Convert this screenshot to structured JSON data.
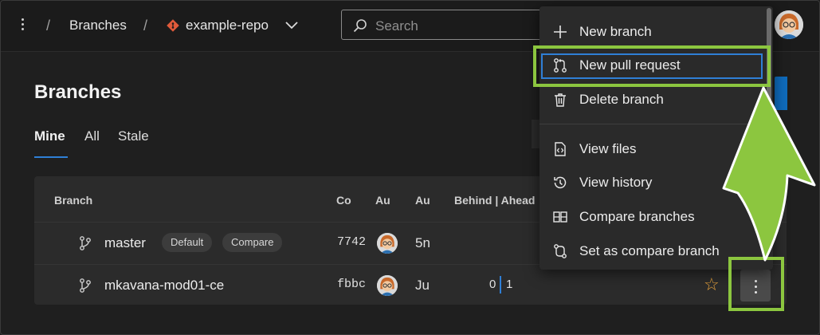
{
  "topbar": {
    "breadcrumb_sep1": "/",
    "breadcrumb_branches": "Branches",
    "breadcrumb_sep2": "/",
    "repo_name": "example-repo",
    "search_placeholder": "Search"
  },
  "page": {
    "title": "Branches",
    "tabs": [
      "Mine",
      "All",
      "Stale"
    ],
    "active_tab": "Mine"
  },
  "table": {
    "headers": [
      "Branch",
      "Co",
      "Au",
      "Au",
      "Behind | Ahead"
    ],
    "rows": [
      {
        "name": "master",
        "badges": [
          "Default",
          "Compare"
        ],
        "commit": "7742",
        "age": "5n"
      },
      {
        "name": "mkavana-mod01-ce",
        "commit": "fbbc",
        "age": "Ju",
        "behind": "0",
        "ahead": "1"
      }
    ]
  },
  "menu": {
    "items": [
      {
        "label": "New branch",
        "icon": "plus-icon"
      },
      {
        "label": "New pull request",
        "icon": "pull-request-icon"
      },
      {
        "label": "Delete branch",
        "icon": "trash-icon"
      },
      {
        "label": "View files",
        "icon": "code-file-icon"
      },
      {
        "label": "View history",
        "icon": "history-icon"
      },
      {
        "label": "Compare branches",
        "icon": "compare-icon"
      },
      {
        "label": "Set as compare branch",
        "icon": "set-compare-icon"
      }
    ]
  },
  "colors": {
    "accent": "#0f6cbd",
    "highlight": "#8cc63f",
    "star": "#e8a33d",
    "repo_icon": "#e05a3a"
  }
}
